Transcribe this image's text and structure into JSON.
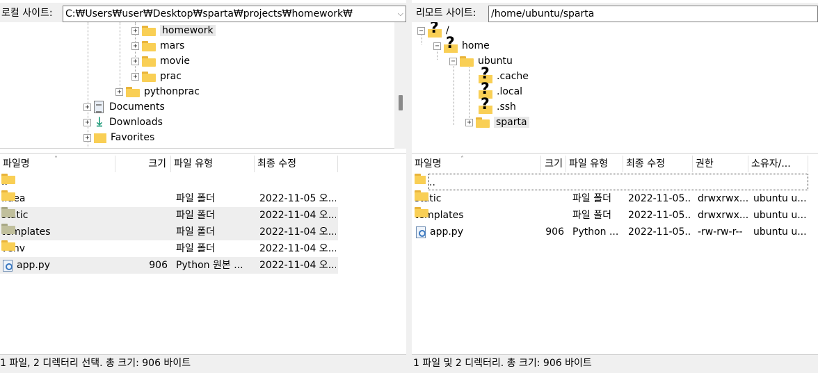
{
  "local": {
    "site_label": "로컬 사이트:",
    "path": "C:₩Users₩user₩Desktop₩sparta₩projects₩homework₩",
    "tree": [
      {
        "label": "homework",
        "type": "folder",
        "selected": true
      },
      {
        "label": "mars",
        "type": "folder"
      },
      {
        "label": "movie",
        "type": "folder"
      },
      {
        "label": "prac",
        "type": "folder"
      },
      {
        "label": "pythonprac",
        "type": "folder"
      },
      {
        "label": "Documents",
        "type": "documents"
      },
      {
        "label": "Downloads",
        "type": "downloads"
      },
      {
        "label": "Favorites",
        "type": "favorites"
      }
    ],
    "columns": [
      "파일명",
      "크기",
      "파일 유형",
      "최종 수정"
    ],
    "rows": [
      {
        "name": "..",
        "size": "",
        "type": "",
        "modified": ""
      },
      {
        "name": ".idea",
        "size": "",
        "type": "파일 폴더",
        "modified": "2022-11-05 오..."
      },
      {
        "name": "static",
        "size": "",
        "type": "파일 폴더",
        "modified": "2022-11-04 오..."
      },
      {
        "name": "templates",
        "size": "",
        "type": "파일 폴더",
        "modified": "2022-11-04 오..."
      },
      {
        "name": "venv",
        "size": "",
        "type": "파일 폴더",
        "modified": "2022-11-04 오..."
      },
      {
        "name": "app.py",
        "size": "906",
        "type": "Python 원본 ...",
        "modified": "2022-11-04 오..."
      }
    ],
    "status": "1 파일, 2 디렉터리 선택. 총 크기: 906 바이트"
  },
  "remote": {
    "site_label": "리모트 사이트:",
    "path": "/home/ubuntu/sparta",
    "tree": [
      {
        "label": "/",
        "type": "unknown"
      },
      {
        "label": "home",
        "type": "unknown"
      },
      {
        "label": "ubuntu",
        "type": "folder"
      },
      {
        "label": ".cache",
        "type": "unknown"
      },
      {
        "label": ".local",
        "type": "unknown"
      },
      {
        "label": ".ssh",
        "type": "unknown"
      },
      {
        "label": "sparta",
        "type": "folder",
        "selected": true
      }
    ],
    "columns": [
      "파일명",
      "크기",
      "파일 유형",
      "최종 수정",
      "권한",
      "소유자/..."
    ],
    "rows": [
      {
        "name": "..",
        "size": "",
        "type": "",
        "modified": "",
        "perm": "",
        "owner": ""
      },
      {
        "name": "static",
        "size": "",
        "type": "파일 폴더",
        "modified": "2022-11-05...",
        "perm": "drwxrwx...",
        "owner": "ubuntu u..."
      },
      {
        "name": "templates",
        "size": "",
        "type": "파일 폴더",
        "modified": "2022-11-05...",
        "perm": "drwxrwx...",
        "owner": "ubuntu u..."
      },
      {
        "name": "app.py",
        "size": "906",
        "type": "Python ...",
        "modified": "2022-11-05...",
        "perm": "-rw-rw-r--",
        "owner": "ubuntu u..."
      }
    ],
    "status": "1 파일 및 2 디렉터리. 총 크기: 906 바이트"
  },
  "icons": {
    "sort": "sort-up-arrow-icon",
    "dropdown": "chevron-down-icon"
  }
}
